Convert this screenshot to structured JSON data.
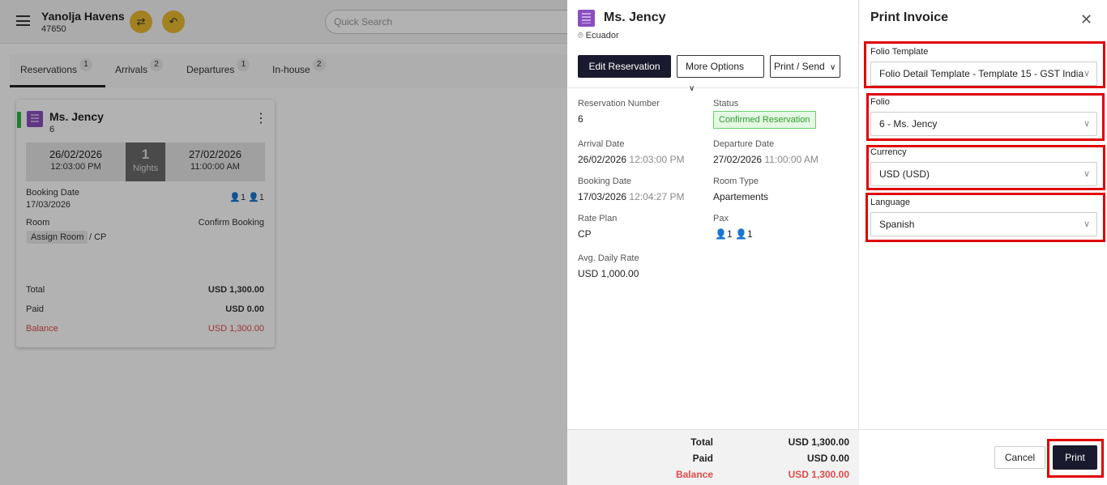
{
  "app": {
    "hotel_name": "Yanolja Havens",
    "hotel_code": "47650",
    "search_placeholder": "Quick Search",
    "tabs": [
      {
        "label": "Reservations",
        "count": "1"
      },
      {
        "label": "Arrivals",
        "count": "2"
      },
      {
        "label": "Departures",
        "count": "1"
      },
      {
        "label": "In-house",
        "count": "2"
      }
    ]
  },
  "card": {
    "guest_name": "Ms. Jency",
    "number": "6",
    "arrival_date": "26/02/2026",
    "arrival_time": "12:03:00 PM",
    "nights_count": "1",
    "nights_label": "Nights",
    "departure_date": "27/02/2026",
    "departure_time": "11:00:00 AM",
    "booking_date_label": "Booking Date",
    "booking_date": "17/03/2026",
    "adults": "1",
    "children": "1",
    "room_label": "Room",
    "status_text": "Confirm Booking",
    "assign_room": "Assign Room",
    "rate_plan_suffix": "/ CP",
    "total_label": "Total",
    "total_value": "USD 1,300.00",
    "paid_label": "Paid",
    "paid_value": "USD 0.00",
    "balance_label": "Balance",
    "balance_value": "USD 1,300.00"
  },
  "reservation": {
    "guest_name": "Ms. Jency",
    "location": "Ecuador",
    "edit_button": "Edit Reservation",
    "more_options": "More Options",
    "print_send": "Print / Send",
    "fields": {
      "res_number_label": "Reservation Number",
      "res_number": "6",
      "status_label": "Status",
      "status": "Confirmed Reservation",
      "arrival_label": "Arrival Date",
      "arrival_date": "26/02/2026",
      "arrival_time": "12:03:00 PM",
      "departure_label": "Departure Date",
      "departure_date": "27/02/2026",
      "departure_time": "11:00:00 AM",
      "booking_label": "Booking Date",
      "booking_date": "17/03/2026",
      "booking_time": "12:04:27 PM",
      "room_type_label": "Room Type",
      "room_type": "Apartements",
      "rate_plan_label": "Rate Plan",
      "rate_plan": "CP",
      "pax_label": "Pax",
      "pax_adults": "1",
      "pax_children": "1",
      "adr_label": "Avg. Daily Rate",
      "adr": "USD 1,000.00"
    },
    "footer": {
      "total_label": "Total",
      "total_value": "USD 1,300.00",
      "paid_label": "Paid",
      "paid_value": "USD 0.00",
      "balance_label": "Balance",
      "balance_value": "USD 1,300.00"
    }
  },
  "print_invoice": {
    "title": "Print Invoice",
    "folio_template_label": "Folio Template",
    "folio_template_value": "Folio Detail Template - Template 15 - GST India",
    "folio_label": "Folio",
    "folio_value": "6 - Ms. Jency",
    "currency_label": "Currency",
    "currency_value": "USD (USD)",
    "language_label": "Language",
    "language_value": "Spanish",
    "cancel_button": "Cancel",
    "print_button": "Print"
  },
  "colors": {
    "accent_dark": "#1a1a2e",
    "highlight": "#e00000",
    "balance_red": "#e24a4a",
    "status_green": "#2e9e2e",
    "action_yellow": "#e8b930"
  }
}
